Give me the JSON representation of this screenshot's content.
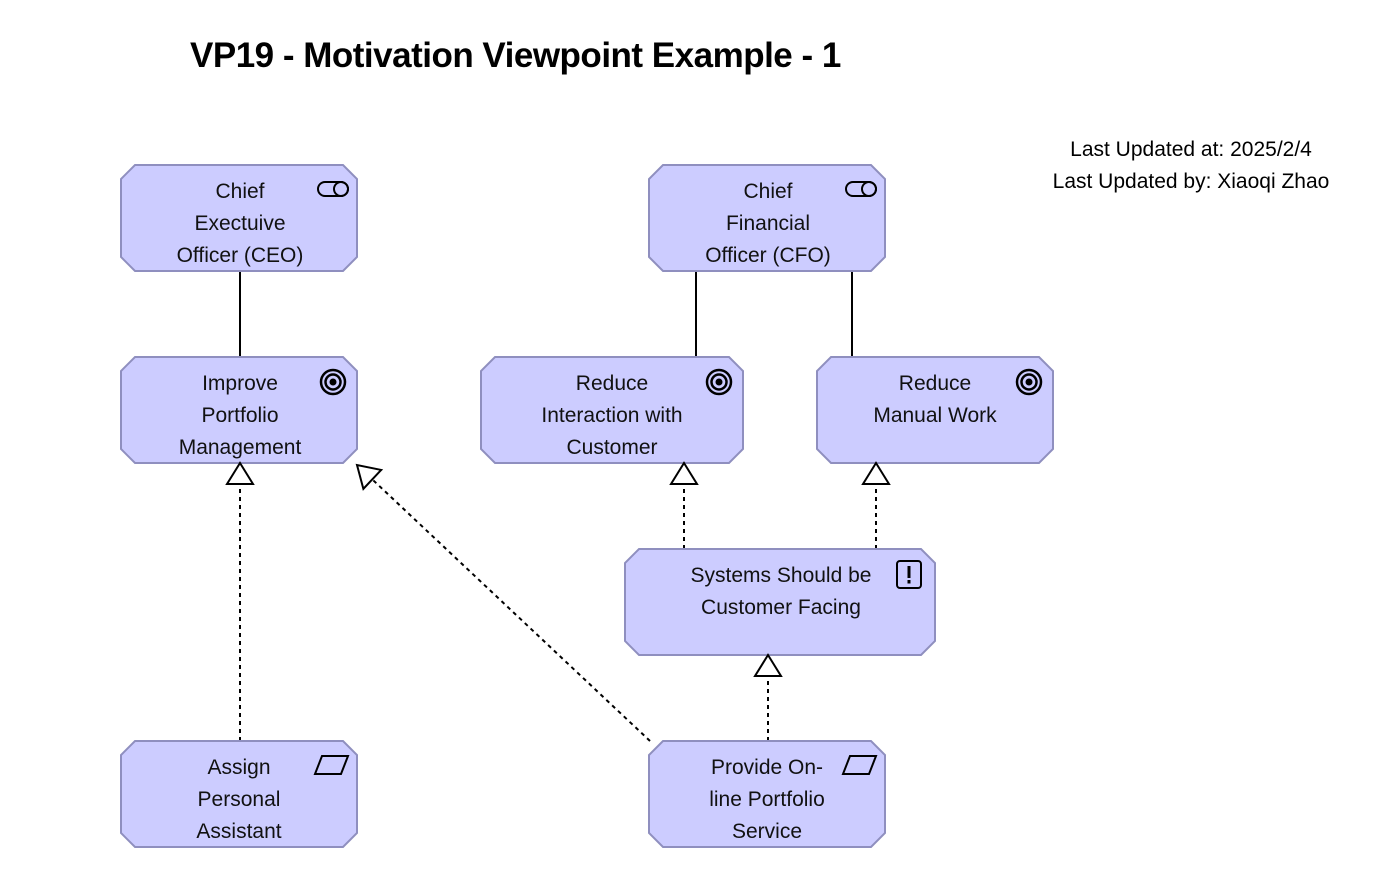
{
  "title": "VP19 - Motivation Viewpoint Example - 1",
  "meta": {
    "updated_at": "Last Updated at: 2025/2/4",
    "updated_by": "Last Updated by: Xiaoqi Zhao"
  },
  "colors": {
    "node_fill": "#ccccff",
    "node_stroke": "#8f8fbf",
    "line": "#000000",
    "background": "#ffffff"
  },
  "nodes": [
    {
      "id": "ceo",
      "type": "stakeholder",
      "icon": "stakeholder-icon",
      "lines": [
        "Chief",
        "Exectuive",
        "Officer (CEO)"
      ]
    },
    {
      "id": "cfo",
      "type": "stakeholder",
      "icon": "stakeholder-icon",
      "lines": [
        "Chief",
        "Financial",
        "Officer (CFO)"
      ]
    },
    {
      "id": "improve",
      "type": "goal",
      "icon": "goal-icon",
      "lines": [
        "Improve",
        "Portfolio",
        "Management"
      ]
    },
    {
      "id": "reduce-interaction",
      "type": "goal",
      "icon": "goal-icon",
      "lines": [
        "Reduce",
        "Interaction with",
        "Customer"
      ]
    },
    {
      "id": "reduce-manual",
      "type": "goal",
      "icon": "goal-icon",
      "lines": [
        "Reduce",
        "Manual Work"
      ]
    },
    {
      "id": "systems",
      "type": "principle",
      "icon": "principle-icon",
      "lines": [
        "Systems Should be",
        "Customer Facing"
      ]
    },
    {
      "id": "assign",
      "type": "requirement",
      "icon": "requirement-icon",
      "lines": [
        "Assign",
        "Personal",
        "Assistant"
      ]
    },
    {
      "id": "provide",
      "type": "requirement",
      "icon": "requirement-icon",
      "lines": [
        "Provide On-",
        "line Portfolio",
        "Service"
      ]
    }
  ],
  "edges": [
    {
      "from": "ceo",
      "to": "improve",
      "type": "association"
    },
    {
      "from": "cfo",
      "to": "reduce-interaction",
      "type": "association"
    },
    {
      "from": "cfo",
      "to": "reduce-manual",
      "type": "association"
    },
    {
      "from": "assign",
      "to": "improve",
      "type": "realization"
    },
    {
      "from": "provide",
      "to": "improve",
      "type": "realization"
    },
    {
      "from": "systems",
      "to": "reduce-interaction",
      "type": "realization"
    },
    {
      "from": "systems",
      "to": "reduce-manual",
      "type": "realization"
    },
    {
      "from": "provide",
      "to": "systems",
      "type": "realization"
    }
  ]
}
